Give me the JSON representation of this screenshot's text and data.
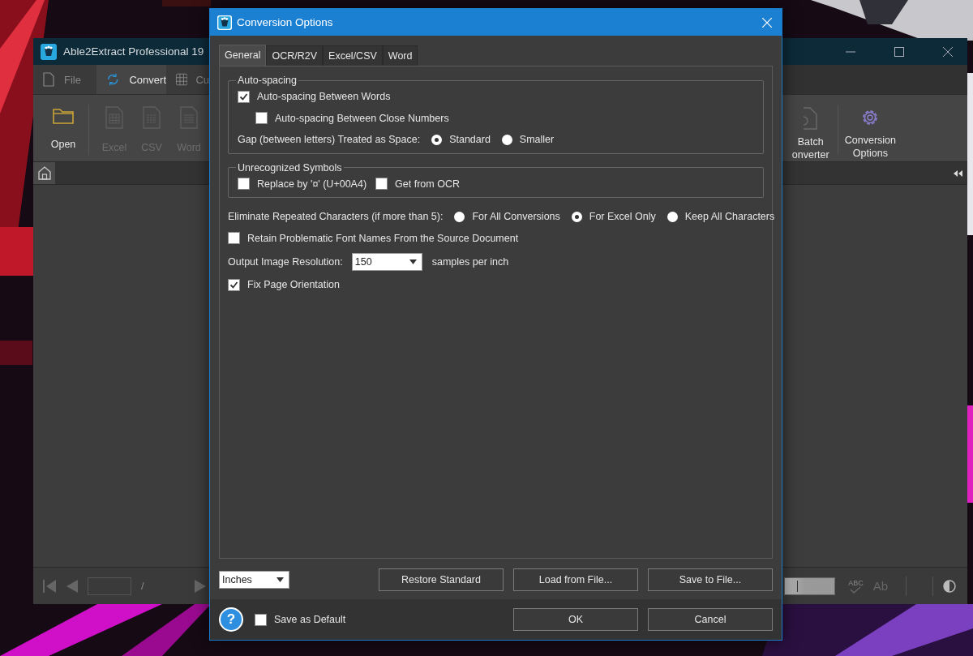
{
  "app_window": {
    "title": "Able2Extract Professional 19",
    "menu_tabs": [
      {
        "label": "File",
        "kind": "file",
        "selected": false
      },
      {
        "label": "Convert",
        "kind": "convert",
        "selected": true
      },
      {
        "label": "Cu",
        "kind": "grid",
        "selected": false
      }
    ],
    "ribbon_left": [
      {
        "label": "Open",
        "kind": "folder",
        "disabled": false
      },
      {
        "label": "Excel",
        "kind": "sheet",
        "disabled": true
      },
      {
        "label": "CSV",
        "kind": "csv",
        "disabled": true
      },
      {
        "label": "Word",
        "kind": "doc",
        "disabled": true
      }
    ],
    "ribbon_right": [
      {
        "lines": [
          "Batch",
          "onverter"
        ],
        "kind": "batch",
        "disabled": false
      },
      {
        "lines": [
          "Conversion",
          "Options"
        ],
        "kind": "gear",
        "disabled": false
      }
    ],
    "bottom_bar": {
      "page_separator": "/",
      "zoom": {
        "level": 0.25
      },
      "spellcheck_label": "ABC",
      "font_label": "Ab"
    }
  },
  "dialog": {
    "title": "Conversion Options",
    "tabs": [
      {
        "label": "General",
        "selected": true
      },
      {
        "label": "OCR/R2V",
        "selected": false
      },
      {
        "label": "Excel/CSV",
        "selected": false
      },
      {
        "label": "Word",
        "selected": false
      }
    ],
    "sections": [
      {
        "kind": "group",
        "title": "Auto-spacing",
        "rows": [
          {
            "kind": "checkbox",
            "label": "Auto-spacing Between Words",
            "checked": true,
            "indent": false
          },
          {
            "kind": "checkbox",
            "label": "Auto-spacing Between Close Numbers",
            "checked": false,
            "indent": true
          },
          {
            "kind": "radios",
            "label": "Gap (between letters) Treated as Space:",
            "options": [
              {
                "label": "Standard",
                "selected": true
              },
              {
                "label": "Smaller",
                "selected": false
              }
            ]
          }
        ]
      },
      {
        "kind": "group",
        "title": "Unrecognized Symbols",
        "rows": [
          {
            "kind": "checks",
            "items": [
              {
                "label": "Replace by '¤' (U+00A4)",
                "checked": false
              },
              {
                "label": "Get from OCR",
                "checked": false
              }
            ]
          }
        ]
      },
      {
        "kind": "radios",
        "label": "Eliminate Repeated Characters (if more than 5):",
        "options": [
          {
            "label": "For All Conversions",
            "selected": false
          },
          {
            "label": "For Excel Only",
            "selected": true
          },
          {
            "label": "Keep All Characters",
            "selected": false
          }
        ]
      },
      {
        "kind": "checkbox",
        "label": "Retain Problematic Font Names From the Source Document",
        "checked": false,
        "indent": false
      },
      {
        "kind": "select",
        "label": "Output Image Resolution:",
        "value": "150",
        "suffix": "samples per inch"
      },
      {
        "kind": "checkbox",
        "label": "Fix Page Orientation",
        "checked": true,
        "indent": false
      }
    ],
    "units": "Inches",
    "file_buttons": [
      "Restore Standard",
      "Load from File...",
      "Save to File..."
    ],
    "help_label": "?",
    "save_default": {
      "label": "Save as Default",
      "checked": false
    },
    "buttons": [
      "OK",
      "Cancel"
    ]
  }
}
